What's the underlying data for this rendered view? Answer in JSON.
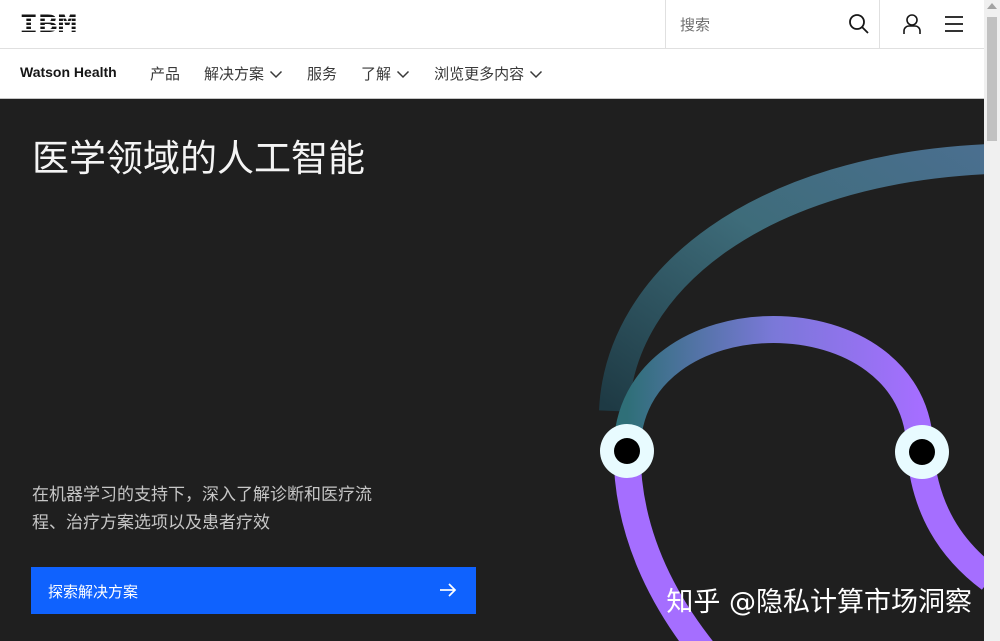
{
  "masthead": {
    "logo": "IBM",
    "search": {
      "placeholder": "搜索",
      "value": ""
    },
    "icons": {
      "search": "search-icon",
      "user": "user-icon",
      "menu": "hamburger-menu-icon"
    }
  },
  "subnav": {
    "brand": "Watson Health",
    "items": [
      {
        "label": "产品",
        "dropdown": false
      },
      {
        "label": "解决方案",
        "dropdown": true
      },
      {
        "label": "服务",
        "dropdown": false
      },
      {
        "label": "了解",
        "dropdown": true
      },
      {
        "label": "浏览更多内容",
        "dropdown": true
      }
    ]
  },
  "hero": {
    "title": "医学领域的人工智能",
    "description": "在机器学习的支持下，深入了解诊断和医疗流程、治疗方案选项以及患者疗效",
    "cta_label": "探索解决方案"
  },
  "watermark": "知乎 @隐私计算市场洞察",
  "colors": {
    "accent_blue": "#0f62fe",
    "hero_bg": "#1f1f1f",
    "arc_purple": "#a56eff",
    "arc_teal": "#3e6c7a"
  }
}
